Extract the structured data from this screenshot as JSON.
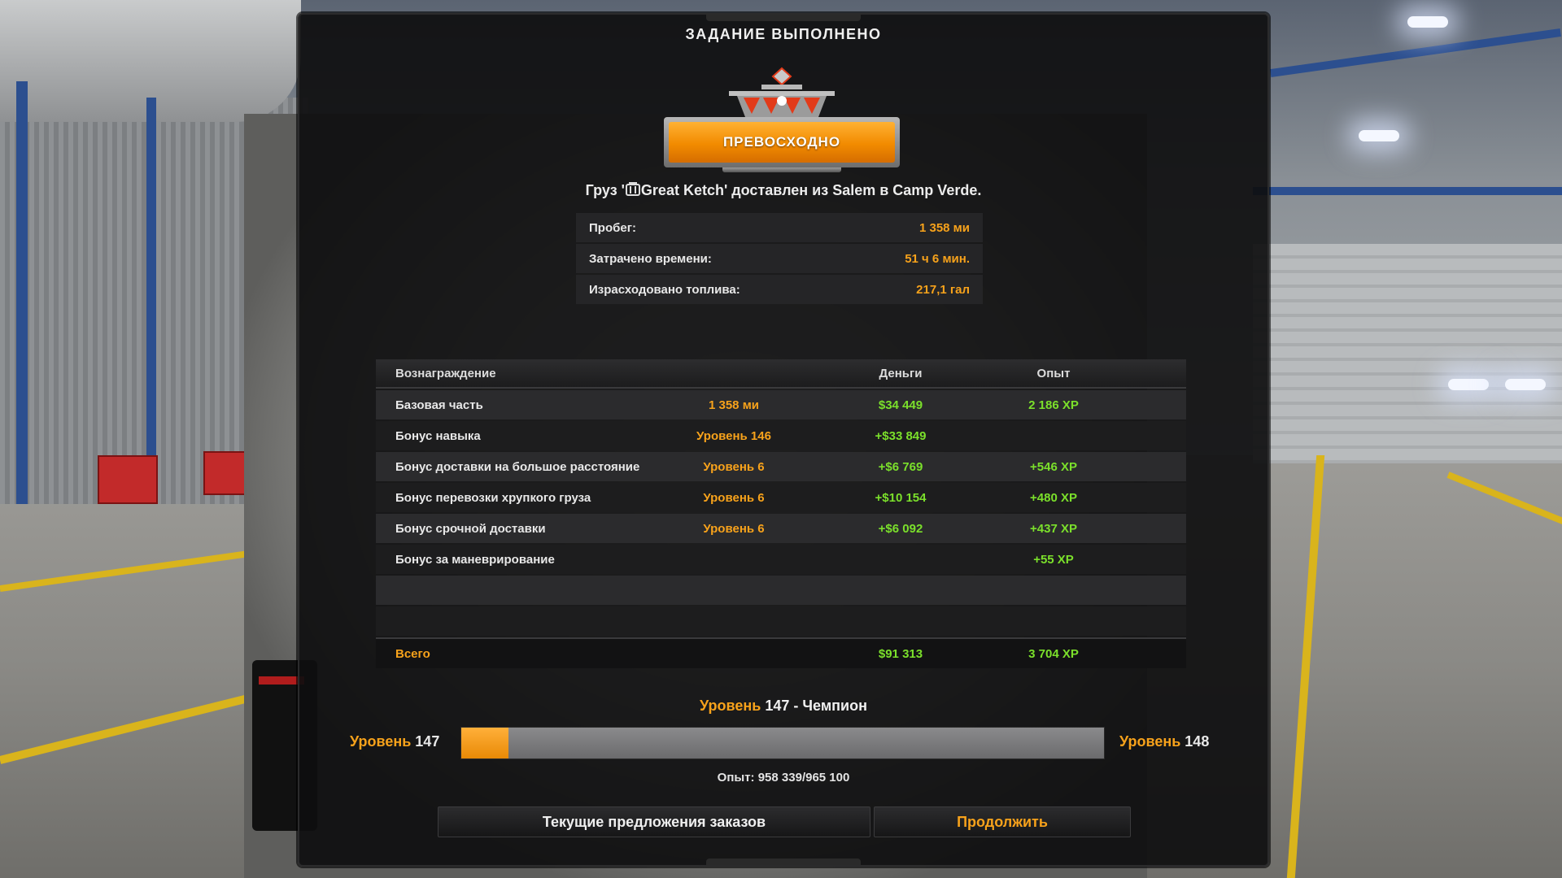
{
  "title": "ЗАДАНИЕ ВЫПОЛНЕНО",
  "badge": {
    "label": "ПРЕВОСХОДНО"
  },
  "cargo": {
    "prefix": "Груз '",
    "name": "Great Ketch",
    "suffix": "' доставлен из Salem в Camp Verde."
  },
  "stats": [
    {
      "label": "Пробег:",
      "value": "1 358 ми"
    },
    {
      "label": "Затрачено времени:",
      "value": "51 ч 6 мин."
    },
    {
      "label": "Израсходовано топлива:",
      "value": "217,1 гал"
    }
  ],
  "rewards": {
    "headers": {
      "reward": "Вознаграждение",
      "money": "Деньги",
      "xp": "Опыт"
    },
    "rows": [
      {
        "name": "Базовая часть",
        "detail": "1 358 ми",
        "money": "$34 449",
        "xp": "2 186 XP"
      },
      {
        "name": "Бонус навыка",
        "detail": "Уровень 146",
        "money": "+$33 849",
        "xp": ""
      },
      {
        "name": "Бонус доставки на большое расстояние",
        "detail": "Уровень 6",
        "money": "+$6 769",
        "xp": "+546 XP"
      },
      {
        "name": "Бонус перевозки хрупкого груза",
        "detail": "Уровень 6",
        "money": "+$10 154",
        "xp": "+480 XP"
      },
      {
        "name": "Бонус срочной доставки",
        "detail": "Уровень 6",
        "money": "+$6 092",
        "xp": "+437 XP"
      },
      {
        "name": "Бонус за маневрирование",
        "detail": "",
        "money": "",
        "xp": "+55 XP"
      },
      {
        "name": "",
        "detail": "",
        "money": "",
        "xp": ""
      },
      {
        "name": "",
        "detail": "",
        "money": "",
        "xp": ""
      }
    ],
    "total": {
      "label": "Всего",
      "money": "$91 313",
      "xp": "3 704 XP"
    }
  },
  "level": {
    "word": "Уровень",
    "current": "147",
    "rank": "- Чемпион",
    "next": "148",
    "progress": 0.073,
    "xp_text": "Опыт: 958 339/965 100"
  },
  "buttons": {
    "offers": "Текущие предложения заказов",
    "continue": "Продолжить"
  },
  "colors": {
    "accent": "#f7a21b",
    "positive": "#7be02b"
  }
}
